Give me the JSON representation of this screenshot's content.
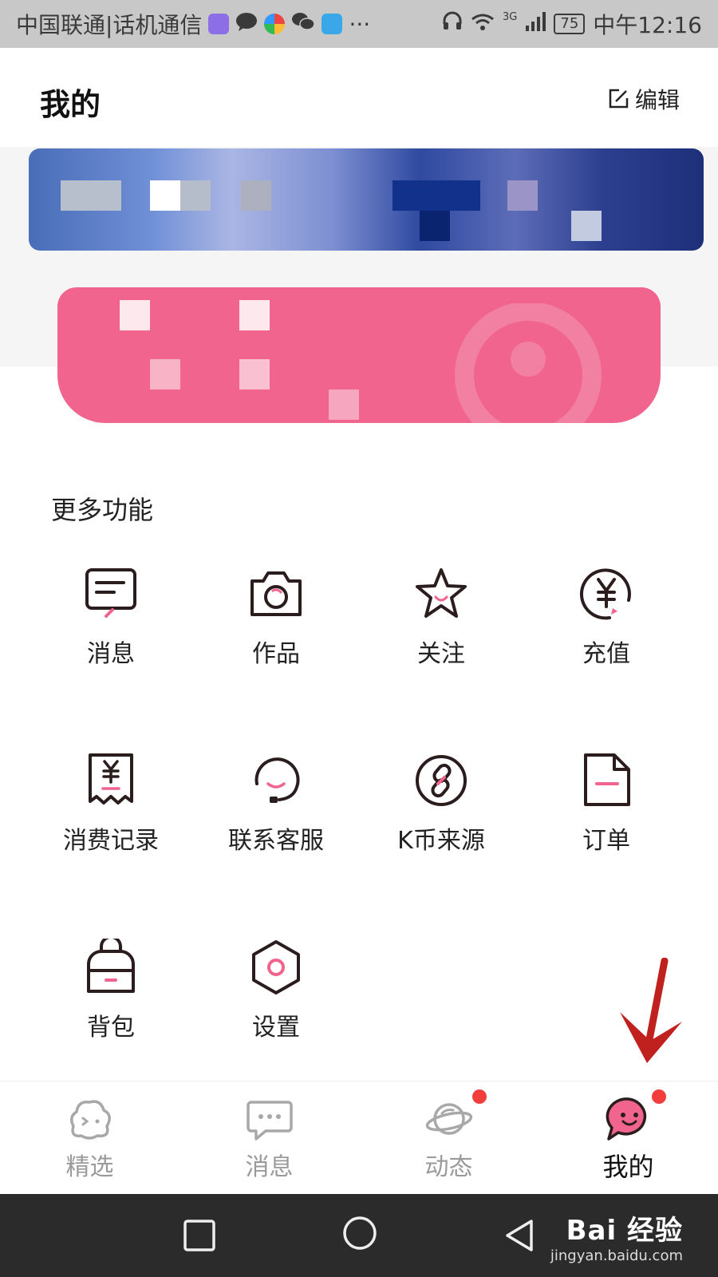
{
  "status_bar": {
    "carrier": "中国联通|话机通信",
    "more": "···",
    "network": "3G",
    "battery": "75",
    "time": "中午12:16"
  },
  "header": {
    "title": "我的",
    "edit_label": "编辑"
  },
  "section": {
    "title": "更多功能"
  },
  "features": [
    {
      "label": "消息",
      "icon": "message-icon"
    },
    {
      "label": "作品",
      "icon": "camera-icon"
    },
    {
      "label": "关注",
      "icon": "star-icon"
    },
    {
      "label": "充值",
      "icon": "yen-coin-icon"
    },
    {
      "label": "消费记录",
      "icon": "receipt-icon"
    },
    {
      "label": "联系客服",
      "icon": "headset-icon"
    },
    {
      "label": "K币来源",
      "icon": "link-icon"
    },
    {
      "label": "订单",
      "icon": "document-icon"
    },
    {
      "label": "背包",
      "icon": "backpack-icon"
    },
    {
      "label": "设置",
      "icon": "hexagon-settings-icon"
    }
  ],
  "bottom_nav": [
    {
      "label": "精选",
      "icon": "featured-face-icon",
      "badge": false,
      "active": false
    },
    {
      "label": "消息",
      "icon": "chat-bubble-icon",
      "badge": false,
      "active": false
    },
    {
      "label": "动态",
      "icon": "planet-icon",
      "badge": true,
      "active": false
    },
    {
      "label": "我的",
      "icon": "smile-bubble-icon",
      "badge": true,
      "active": true
    }
  ],
  "watermark": {
    "main": "Bai 经验",
    "sub": "jingyan.baidu.com"
  },
  "colors": {
    "accent_pink": "#f0648e",
    "badge_red": "#f23d3d",
    "arrow_red": "#c0211f"
  }
}
